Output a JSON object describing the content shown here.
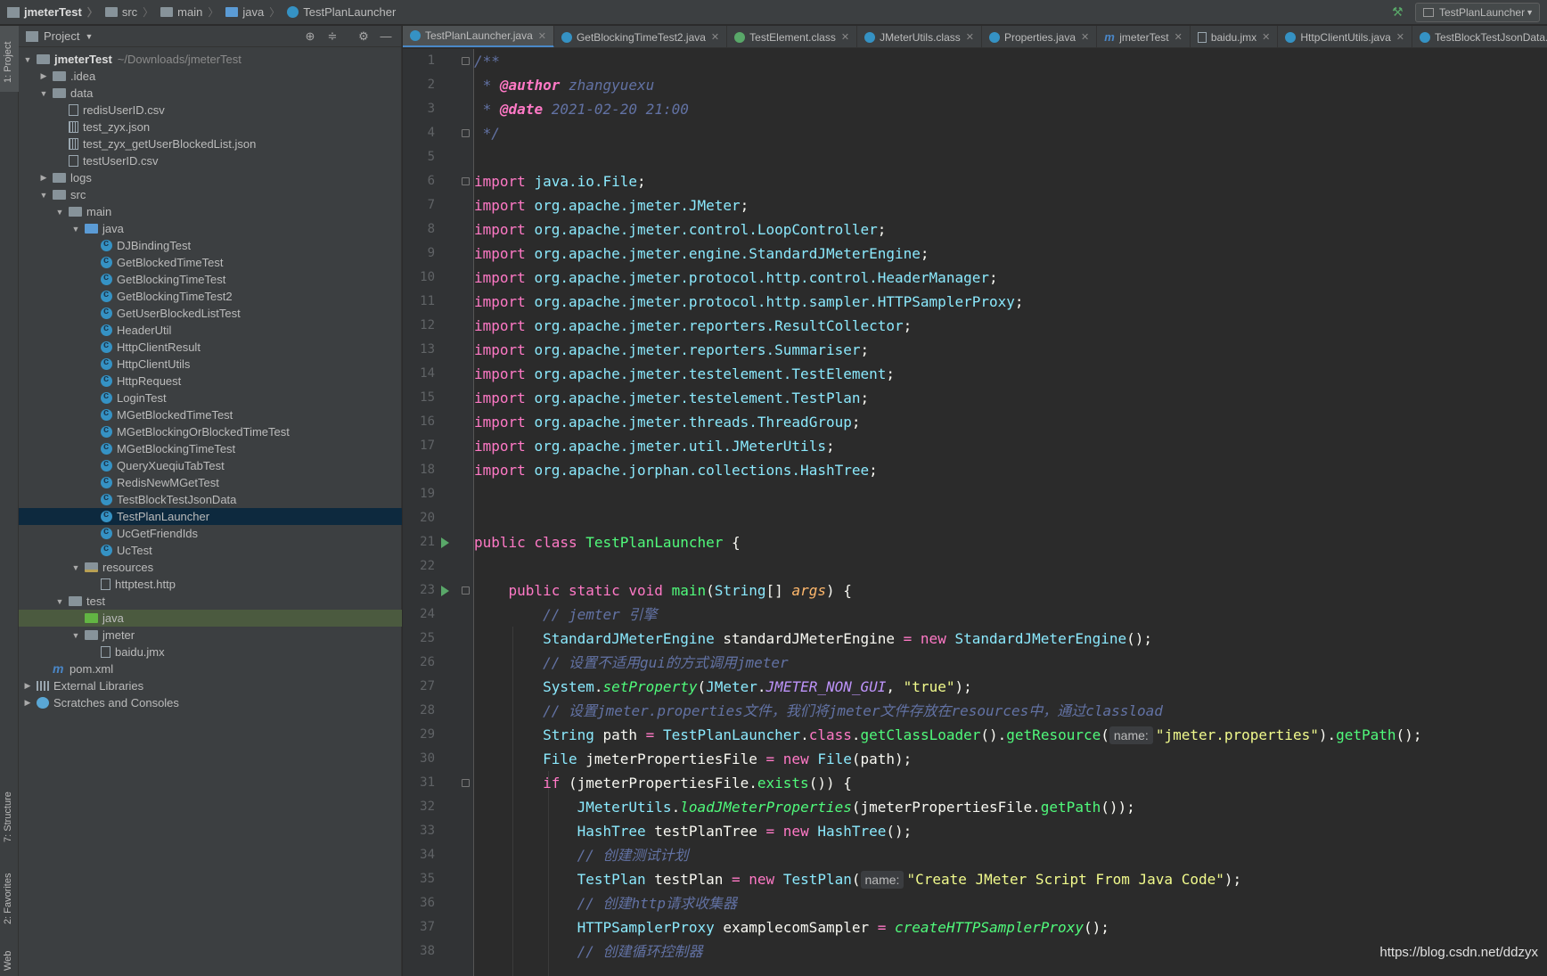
{
  "navbar": {
    "crumbs": [
      "jmeterTest",
      "src",
      "main",
      "java",
      "TestPlanLauncher"
    ],
    "run_config": "TestPlanLauncher"
  },
  "toolstrip": {
    "project": "1: Project",
    "structure": "7: Structure",
    "favorites": "2: Favorites",
    "web": "Web"
  },
  "project_panel": {
    "title": "Project",
    "root_name": "jmeterTest",
    "root_path": "~/Downloads/jmeterTest",
    "items": [
      ".idea",
      "data",
      "redisUserID.csv",
      "test_zyx.json",
      "test_zyx_getUserBlockedList.json",
      "testUserID.csv",
      "logs",
      "src",
      "main",
      "java",
      "DJBindingTest",
      "GetBlockedTimeTest",
      "GetBlockingTimeTest",
      "GetBlockingTimeTest2",
      "GetUserBlockedListTest",
      "HeaderUtil",
      "HttpClientResult",
      "HttpClientUtils",
      "HttpRequest",
      "LoginTest",
      "MGetBlockedTimeTest",
      "MGetBlockingOrBlockedTimeTest",
      "MGetBlockingTimeTest",
      "QueryXueqiuTabTest",
      "RedisNewMGetTest",
      "TestBlockTestJsonData",
      "TestPlanLauncher",
      "UcGetFriendIds",
      "UcTest",
      "resources",
      "httptest.http",
      "test",
      "java",
      "jmeter",
      "baidu.jmx",
      "pom.xml",
      "External Libraries",
      "Scratches and Consoles"
    ]
  },
  "tabs": [
    "TestPlanLauncher.java",
    "GetBlockingTimeTest2.java",
    "TestElement.class",
    "JMeterUtils.class",
    "Properties.java",
    "jmeterTest",
    "baidu.jmx",
    "HttpClientUtils.java",
    "TestBlockTestJsonData.java"
  ],
  "editor": {
    "line_numbers": [
      "1",
      "2",
      "3",
      "4",
      "5",
      "6",
      "7",
      "8",
      "9",
      "10",
      "11",
      "12",
      "13",
      "14",
      "15",
      "16",
      "17",
      "18",
      "19",
      "20",
      "21",
      "22",
      "23",
      "24",
      "25",
      "26",
      "27",
      "28",
      "29",
      "30",
      "31",
      "32",
      "33",
      "34",
      "35",
      "36",
      "37",
      "38"
    ],
    "author_tag": "@author",
    "author": "zhangyuexu",
    "date_tag": "@date",
    "date": "2021-02-20 21:00",
    "imports": [
      "java.io.File",
      "org.apache.jmeter.JMeter",
      "org.apache.jmeter.control.LoopController",
      "org.apache.jmeter.engine.StandardJMeterEngine",
      "org.apache.jmeter.protocol.http.control.HeaderManager",
      "org.apache.jmeter.protocol.http.sampler.HTTPSamplerProxy",
      "org.apache.jmeter.reporters.ResultCollector",
      "org.apache.jmeter.reporters.Summariser",
      "org.apache.jmeter.testelement.TestElement",
      "org.apache.jmeter.testelement.TestPlan",
      "org.apache.jmeter.threads.ThreadGroup",
      "org.apache.jmeter.util.JMeterUtils",
      "org.apache.jorphan.collections.HashTree"
    ],
    "class_name": "TestPlanLauncher",
    "comment_24": "// jemter 引擎",
    "comment_26": "// 设置不适用gui的方式调用jmeter",
    "comment_28": "// 设置jmeter.properties文件，我们将jmeter文件存放在resources中，通过classload",
    "comment_34": "// 创建测试计划",
    "comment_36": "// 创建http请求收集器",
    "comment_38": "// 创建循环控制器",
    "str_true": "\"true\"",
    "str_props": "\"jmeter.properties\"",
    "str_plan": "\"Create JMeter Script From Java Code\"",
    "hint_name": "name:"
  },
  "watermark": "https://blog.csdn.net/ddzyx"
}
